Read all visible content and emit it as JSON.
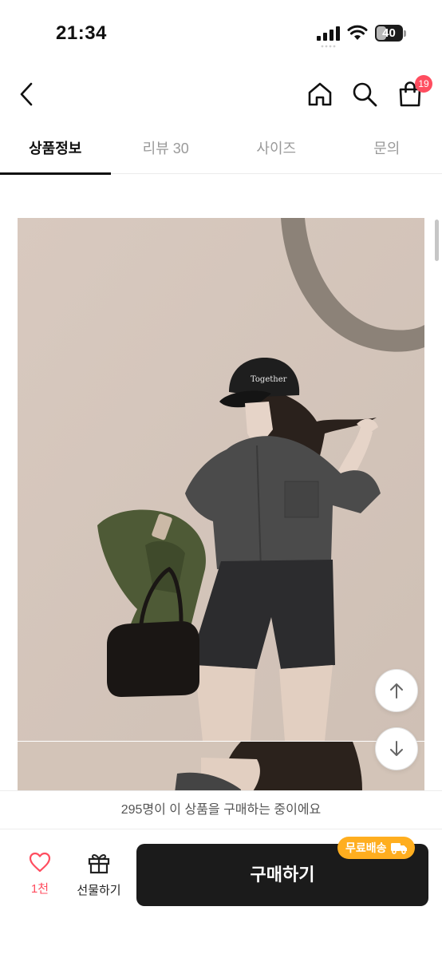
{
  "status_bar": {
    "time": "21:34",
    "battery": "40",
    "battery_level": 0.4
  },
  "header": {
    "back_icon": "chevron-left-icon",
    "home_icon": "home-icon",
    "search_icon": "search-icon",
    "cart_icon": "shopping-bag-icon",
    "cart_count": "19"
  },
  "tabs": [
    {
      "label": "상품정보",
      "active": true
    },
    {
      "label": "리뷰 30",
      "active": false
    },
    {
      "label": "사이즈",
      "active": false
    },
    {
      "label": "문의",
      "active": false
    }
  ],
  "product": {
    "cap_text": "Together"
  },
  "floating": {
    "up_icon": "arrow-up-icon",
    "down_icon": "arrow-down-icon"
  },
  "banner": {
    "text": "295명이 이 상품을 구매하는 중이에요"
  },
  "bottom_bar": {
    "like_count": "1천",
    "gift_label": "선물하기",
    "buy_label": "구매하기",
    "free_shipping_label": "무료배송"
  },
  "colors": {
    "accent_red": "#ff4d5f",
    "buy_button": "#1b1b1b",
    "free_shipping_badge": "#ffae1f"
  }
}
